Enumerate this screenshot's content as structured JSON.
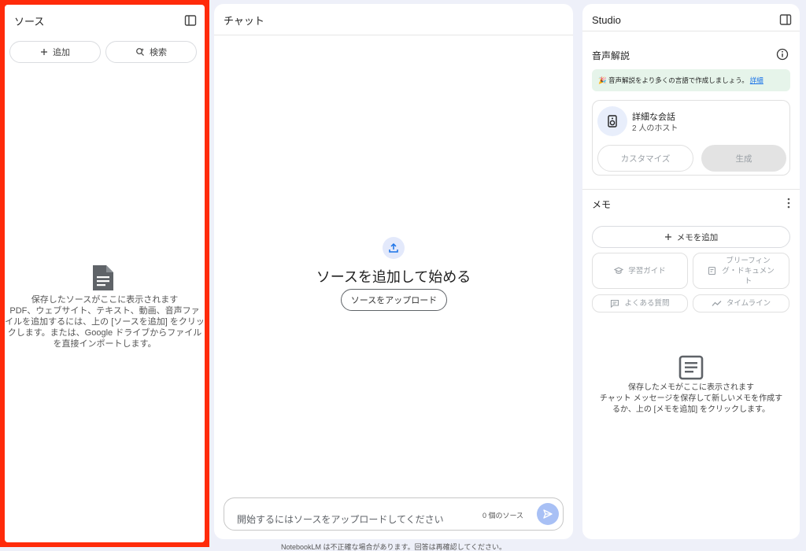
{
  "sources": {
    "title": "ソース",
    "add_label": "追加",
    "search_label": "検索",
    "empty_title": "保存したソースがここに表示されます",
    "empty_lines": [
      "PDF、ウェブサイト、テキスト、動画、音声ファ",
      "イルを追加するには、上の [ソースを追加] をクリッ",
      "クします。または、Google ドライブからファイル",
      "を直接インポートします。"
    ]
  },
  "chat": {
    "title": "チャット",
    "empty_heading": "ソースを追加して始める",
    "upload_label": "ソースをアップロード",
    "input_placeholder": "開始するにはソースをアップロードしてください",
    "source_count": "0 個のソース"
  },
  "footer": {
    "note": "NotebookLM は不正確な場合があります。回答は再確認してください。"
  },
  "studio": {
    "title": "Studio",
    "audio_section_title": "音声解説",
    "banner_text": "🎉 音声解説をより多くの言語で作成しましょう。",
    "banner_link": "詳細",
    "card_title": "詳細な会話",
    "card_subtitle": "2 人のホスト",
    "customize_label": "カスタマイズ",
    "generate_label": "生成",
    "memo_section_title": "メモ",
    "add_memo_label": "メモを追加",
    "study_guide_label": "学習ガイド",
    "briefing_line1": "ブリーフィン",
    "briefing_line2": "グ・ドキュメン",
    "briefing_line3": "ト",
    "faq_label": "よくある質問",
    "timeline_label": "タイムライン",
    "memo_empty_title": "保存したメモがここに表示されます",
    "memo_empty_line1": "チャット メッセージを保存して新しいメモを作成す",
    "memo_empty_line2": "るか、上の [メモを追加] をクリックします。"
  },
  "colors": {
    "highlight": "#ff2b0a",
    "background": "#eef0f9",
    "accent": "#1a73e8"
  }
}
